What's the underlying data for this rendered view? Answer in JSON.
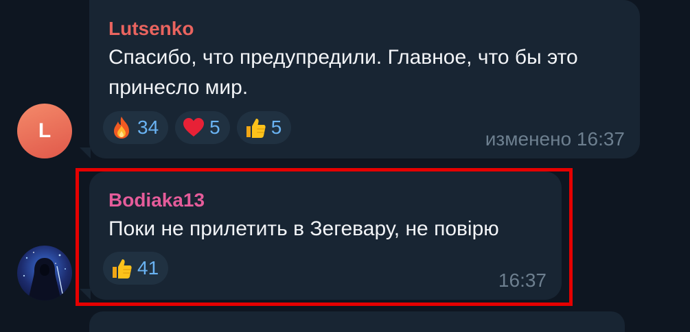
{
  "messages": [
    {
      "author": "Lutsenko",
      "text_lines": [
        "Спасибо, что предупредили. Главное, что бы это",
        "принесло мир."
      ],
      "reactions": [
        {
          "emoji": "fire-icon",
          "count": "34"
        },
        {
          "emoji": "heart-icon",
          "count": "5"
        },
        {
          "emoji": "thumbs-up-icon",
          "count": "5"
        }
      ],
      "time": "изменено 16:37",
      "avatar_initial": "L"
    },
    {
      "author": "Bodiaka13",
      "text_lines": [
        "Поки не прилетить в Зегевару, не повірю"
      ],
      "reactions": [
        {
          "emoji": "thumbs-up-icon",
          "count": "41"
        }
      ],
      "time": "16:37"
    }
  ],
  "colors": {
    "background": "#0e1621",
    "bubble": "#182533",
    "author_1": "#e9645f",
    "author_2": "#e55c9a",
    "reaction_count": "#6ab3f3",
    "highlight": "#e50000"
  }
}
